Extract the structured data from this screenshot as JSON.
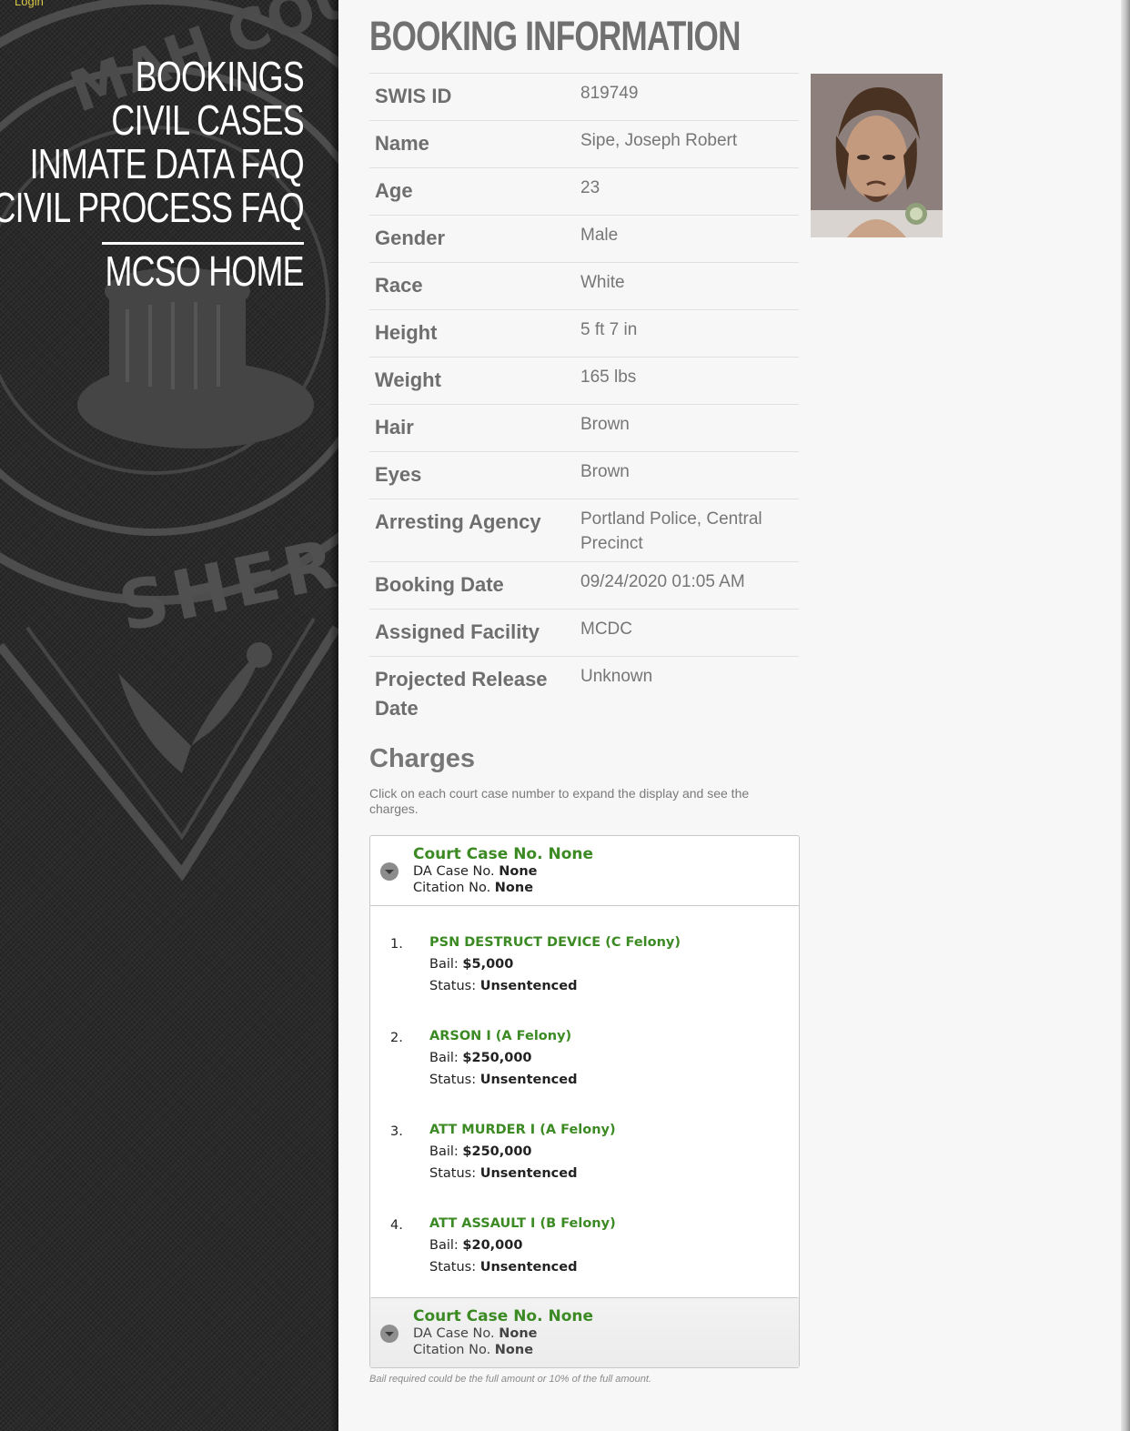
{
  "sidebar": {
    "login_link": "Login",
    "seal_lettering": "MULTNOMAH COUNTY SHERIFF",
    "nav": [
      "BOOKINGS",
      "CIVIL CASES",
      "INMATE DATA FAQ",
      "CIVIL PROCESS FAQ"
    ],
    "home": "MCSO HOME"
  },
  "page": {
    "title": "BOOKING INFORMATION"
  },
  "booking": [
    {
      "label": "SWIS ID",
      "value": "819749"
    },
    {
      "label": "Name",
      "value": "Sipe, Joseph Robert"
    },
    {
      "label": "Age",
      "value": "23"
    },
    {
      "label": "Gender",
      "value": "Male"
    },
    {
      "label": "Race",
      "value": "White"
    },
    {
      "label": "Height",
      "value": "5 ft 7 in"
    },
    {
      "label": "Weight",
      "value": "165 lbs"
    },
    {
      "label": "Hair",
      "value": "Brown"
    },
    {
      "label": "Eyes",
      "value": "Brown"
    },
    {
      "label": "Arresting Agency",
      "value": "Portland Police, Central Precinct"
    },
    {
      "label": "Booking Date",
      "value": "09/24/2020 01:05 AM"
    },
    {
      "label": "Assigned Facility",
      "value": "MCDC"
    },
    {
      "label": "Projected Release Date",
      "value": "Unknown"
    }
  ],
  "charges": {
    "title": "Charges",
    "help": "Click on each court case number to expand the display and see the charges.",
    "cases": [
      {
        "court_case": "Court Case No. None",
        "da_label": "DA Case No.",
        "da_value": "None",
        "citation_label": "Citation No.",
        "citation_value": "None",
        "expanded": true,
        "items": [
          {
            "num": "1.",
            "name": "PSN DESTRUCT DEVICE (C Felony)",
            "bail_label": "Bail:",
            "bail": "$5,000",
            "status_label": "Status:",
            "status": "Unsentenced"
          },
          {
            "num": "2.",
            "name": "ARSON I (A Felony)",
            "bail_label": "Bail:",
            "bail": "$250,000",
            "status_label": "Status:",
            "status": "Unsentenced"
          },
          {
            "num": "3.",
            "name": "ATT MURDER I (A Felony)",
            "bail_label": "Bail:",
            "bail": "$250,000",
            "status_label": "Status:",
            "status": "Unsentenced"
          },
          {
            "num": "4.",
            "name": "ATT ASSAULT I (B Felony)",
            "bail_label": "Bail:",
            "bail": "$20,000",
            "status_label": "Status:",
            "status": "Unsentenced"
          }
        ]
      },
      {
        "court_case": "Court Case No. None",
        "da_label": "DA Case No.",
        "da_value": "None",
        "citation_label": "Citation No.",
        "citation_value": "None",
        "expanded": false,
        "items": []
      }
    ]
  },
  "footnote": "Bail required could be the full amount or 10% of the full amount.",
  "colors": {
    "accent_green": "#3c8a24",
    "login_yellow": "#d9c845",
    "sidebar_bg": "#2a2a2a"
  }
}
